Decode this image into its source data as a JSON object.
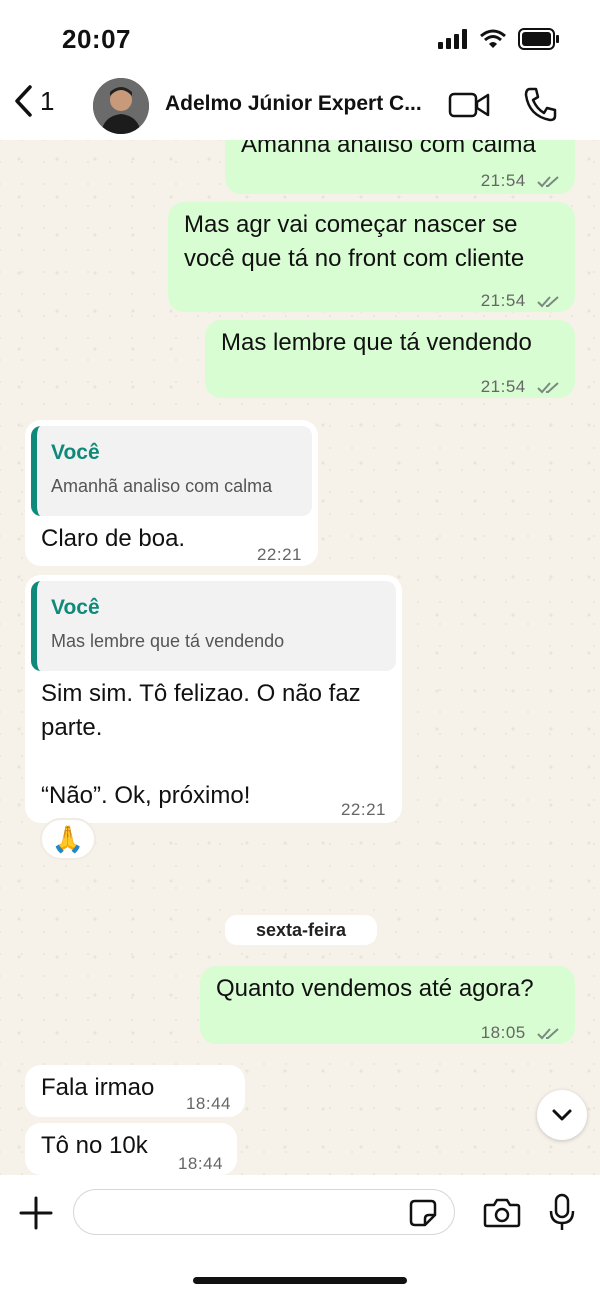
{
  "status_bar": {
    "time": "20:07"
  },
  "header": {
    "back_count": "1",
    "contact_name": "Adelmo Júnior Expert C..."
  },
  "messages": [
    {
      "type": "out",
      "text": "Amanhã analiso com calma",
      "time": "21:54"
    },
    {
      "type": "out",
      "text": "Mas agr vai começar nascer se você que tá no front com cliente",
      "time": "21:54"
    },
    {
      "type": "out",
      "text": "Mas lembre que tá vendendo",
      "time": "21:54"
    },
    {
      "type": "in",
      "quote_name": "Você",
      "quote_text": "Amanhã analiso com calma",
      "text": "Claro de boa.",
      "time": "22:21"
    },
    {
      "type": "in",
      "quote_name": "Você",
      "quote_text": "Mas lembre que tá vendendo",
      "text_line1": "Sim sim. Tô felizao. O não faz",
      "text_line2": "parte.",
      "text_line3": "“Não”. Ok, próximo!",
      "time": "22:21",
      "reaction": "🙏"
    },
    {
      "type": "out",
      "text": "Quanto vendemos até agora?",
      "time": "18:05"
    },
    {
      "type": "in",
      "text": "Fala irmao",
      "time": "18:44"
    },
    {
      "type": "in",
      "text": "Tô no 10k",
      "time": "18:44"
    }
  ],
  "day_separator": "sexta-feira",
  "composer": {
    "placeholder": ""
  },
  "colors": {
    "outgoing": "#d9fdd3",
    "incoming": "#ffffff",
    "accent": "#0f8a7a",
    "ticks": "#7a8a80"
  },
  "icons": [
    "back-chevron-icon",
    "video-call-icon",
    "phone-icon",
    "double-check-icon",
    "chevron-down-icon",
    "plus-icon",
    "sticker-icon",
    "camera-icon",
    "microphone-icon"
  ]
}
